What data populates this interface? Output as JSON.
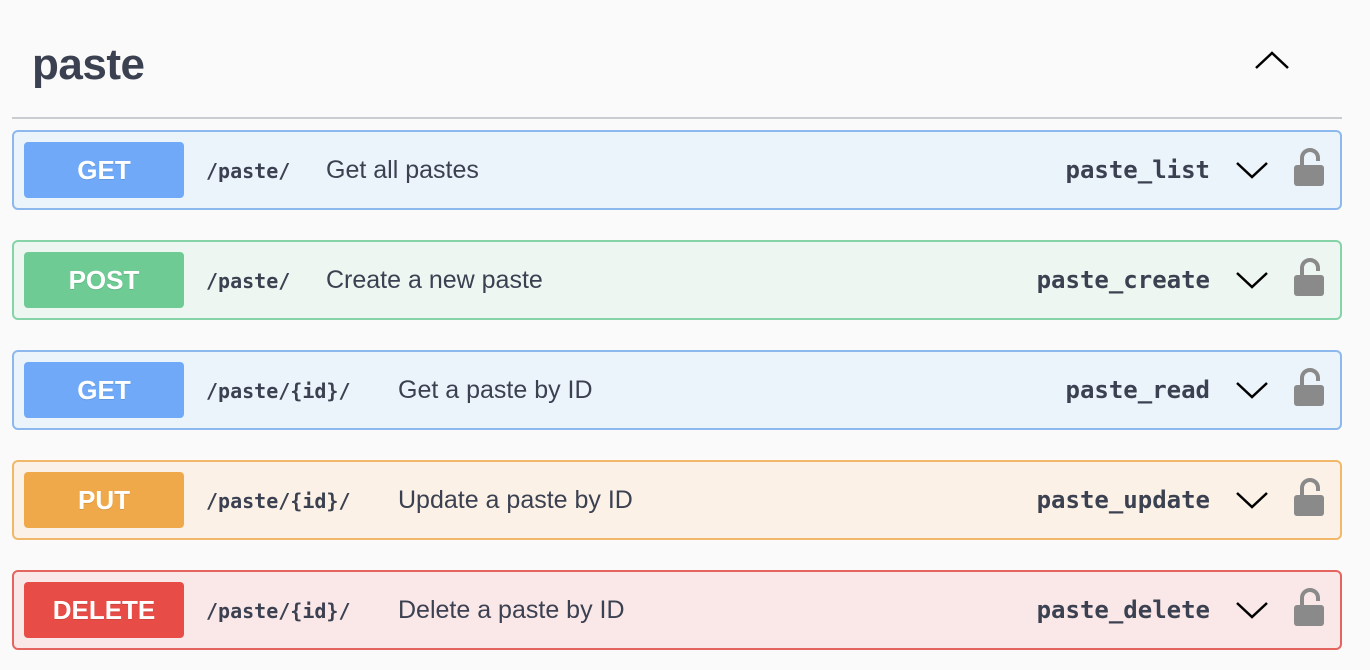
{
  "tag": {
    "title": "paste",
    "toggle_icon": "chevron-up-icon"
  },
  "colors": {
    "get": "#6fa9f7",
    "post": "#6ecb94",
    "put": "#f0a94a",
    "delete": "#e74c46"
  },
  "operations": [
    {
      "method": "GET",
      "path": "/paste/",
      "summary": "Get all pastes",
      "operation_id": "paste_list"
    },
    {
      "method": "POST",
      "path": "/paste/",
      "summary": "Create a new paste",
      "operation_id": "paste_create"
    },
    {
      "method": "GET",
      "path": "/paste/{id}/",
      "summary": "Get a paste by ID",
      "operation_id": "paste_read"
    },
    {
      "method": "PUT",
      "path": "/paste/{id}/",
      "summary": "Update a paste by ID",
      "operation_id": "paste_update"
    },
    {
      "method": "DELETE",
      "path": "/paste/{id}/",
      "summary": "Delete a paste by ID",
      "operation_id": "paste_delete"
    }
  ]
}
